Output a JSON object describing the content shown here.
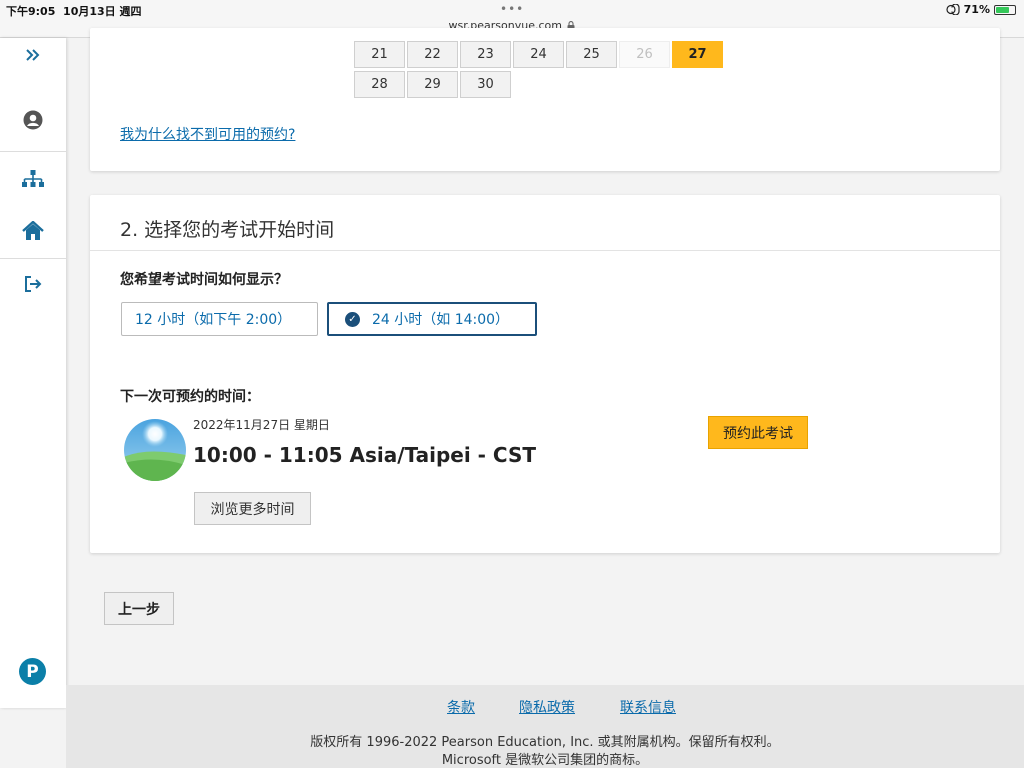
{
  "statusbar": {
    "time": "下午9:05",
    "date": "10月13日 週四",
    "dots": "•••",
    "url": "wsr.pearsonvue.com",
    "battery_percent": "71%",
    "battery_level": 0.71
  },
  "rail": {
    "icons": [
      "expand-icon",
      "user-icon",
      "sitemap-icon",
      "home-icon",
      "sign-out-icon"
    ],
    "brand_letter": "P",
    "brand_color": "#0b7fa8"
  },
  "calendar": {
    "rows": [
      [
        {
          "day": "21",
          "state": "available"
        },
        {
          "day": "22",
          "state": "available"
        },
        {
          "day": "23",
          "state": "available"
        },
        {
          "day": "24",
          "state": "available"
        },
        {
          "day": "25",
          "state": "available"
        },
        {
          "day": "26",
          "state": "disabled"
        },
        {
          "day": "27",
          "state": "selected"
        }
      ],
      [
        {
          "day": "28",
          "state": "available"
        },
        {
          "day": "29",
          "state": "available"
        },
        {
          "day": "30",
          "state": "available"
        }
      ]
    ],
    "help_link": "我为什么找不到可用的预约?"
  },
  "section2": {
    "title": "2. 选择您的考试开始时间",
    "question": "您希望考试时间如何显示？",
    "format_12h": "12 小时（如下午 2:00）",
    "format_24h": "24 小时（如 14:00）",
    "selected_format": "24h",
    "next_label": "下一次可预约的时间：",
    "slot_date": "2022年11月27日 星期日",
    "slot_time": "10:00 - 11:05 Asia/Taipei - CST",
    "book_button": "预约此考试",
    "more_button": "浏览更多时间"
  },
  "nav": {
    "prev_button": "上一步"
  },
  "footer": {
    "links": [
      "条款",
      "隐私政策",
      "联系信息"
    ],
    "copyright": "版权所有 1996-2022 Pearson Education, Inc. 或其附属机构。保留所有权利。",
    "trademark": "Microsoft 是微软公司集团的商标。"
  },
  "colors": {
    "accent": "#ffb81c",
    "link": "#0b6bab",
    "selected_border": "#1b4f7a"
  }
}
